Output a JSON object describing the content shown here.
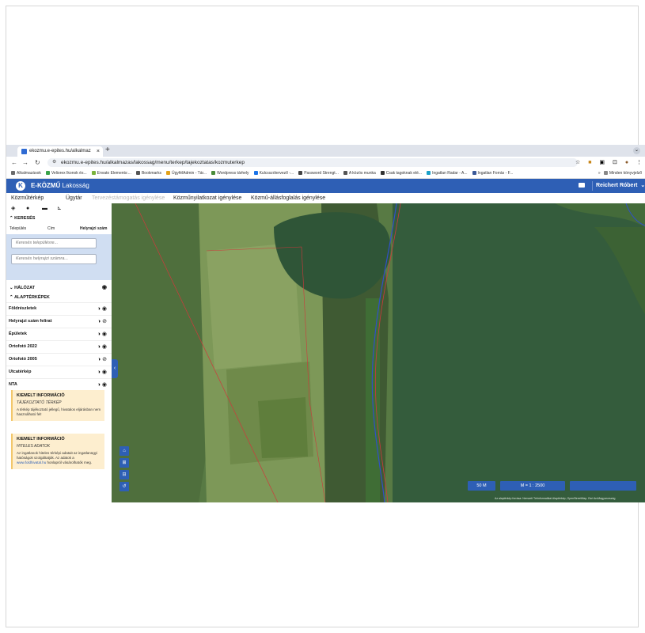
{
  "browser": {
    "tab_title": "ekozmu.e-epites.hu/alkalmaz",
    "url": "ekozmu.e-epites.hu/alkalmazas/lakossag/menu/terkep/tajekoztatas/kozmuterkep",
    "bookmarks": [
      {
        "label": "Alkalmazások",
        "color": "#6b6b6b"
      },
      {
        "label": "Veliorex Ikonok és...",
        "color": "#3aa34a"
      },
      {
        "label": "Envato Elements:...",
        "color": "#7bb33b"
      },
      {
        "label": "Bookmarks",
        "color": "#555555"
      },
      {
        "label": "ÜgyfélAdmin - Tár...",
        "color": "#e3a21a"
      },
      {
        "label": "Wordpress tárhely",
        "color": "#4a8c3a"
      },
      {
        "label": "Kulcsszótervező -...",
        "color": "#1a73e8"
      },
      {
        "label": "Password Strengt...",
        "color": "#444444"
      },
      {
        "label": "A közös munka",
        "color": "#555555"
      },
      {
        "label": "Csak tagoknak elé...",
        "color": "#333333"
      },
      {
        "label": "Ingatlan Radar - A...",
        "color": "#1aa0c8"
      },
      {
        "label": "Ingatlan Forrás - F...",
        "color": "#3b5998"
      }
    ],
    "bookmarks_more": "»",
    "bookmarks_all": "Minden könyvjelző"
  },
  "app": {
    "logo_letter": "K",
    "brand_bold": "E-KÖZMŰ",
    "brand_rest": " Lakosság",
    "user": "Reichert Róbert",
    "menu": [
      {
        "label": "Közműtérkép",
        "disabled": false
      },
      {
        "label": "Ügytár",
        "disabled": false
      },
      {
        "label": "Tervezéstámogatás igénylése",
        "disabled": true
      },
      {
        "label": "Közműnyilatkozat igénylése",
        "disabled": false
      },
      {
        "label": "Közmű-állásfoglalás igénylése",
        "disabled": false
      }
    ]
  },
  "sidebar": {
    "search_title": "KERESÉS",
    "search_tabs": [
      "Település",
      "Cím",
      "Helyrajzi szám"
    ],
    "settlement_placeholder": "Keresés településre...",
    "parcel_placeholder": "Keresés helyrajzi számra...",
    "network_title": "HÁLÓZAT",
    "basemaps_title": "ALAPTÉRKÉPEK",
    "layers": [
      {
        "label": "Földrészletek",
        "visible": true
      },
      {
        "label": "Helyrajzi szám felirat",
        "visible": false
      },
      {
        "label": "Épületek",
        "visible": true
      },
      {
        "label": "Ortofotó 2022",
        "visible": true
      },
      {
        "label": "Ortofotó 2005",
        "visible": false
      },
      {
        "label": "Utcatérkép",
        "visible": true
      },
      {
        "label": "NTA",
        "visible": true
      }
    ],
    "info1": {
      "heading": "KIEMELT INFORMÁCIÓ",
      "subheading": "TÁJÉKOZTATÓ TÉRKÉP",
      "body": "A térkép tájékoztató jellegű, hivatalos eljárásban nem használható fel!"
    },
    "info2": {
      "heading": "KIEMELT INFORMÁCIÓ",
      "subheading": "HITELES ADATOK",
      "body_before": "Az ingatlanok hiteles térképi adatait az ingatlanügyi hatóságok szolgáltatják. Az adatok a ",
      "link": "www.foldhivatal.hu",
      "body_after": " honlapról vásárolhatók meg."
    }
  },
  "map": {
    "scale_bar": "50 M",
    "scale_ratio": "M = 1 : 2500",
    "attribution": "Az alaptérkép forrása: Nemzeti Térinformatikai Alaptérkép, OpenStreetMap, Esri ArcMagyarország",
    "colors": {
      "lake": "#2f5537",
      "field": "#6d8a4a",
      "accent": "#2e5fb5"
    }
  }
}
